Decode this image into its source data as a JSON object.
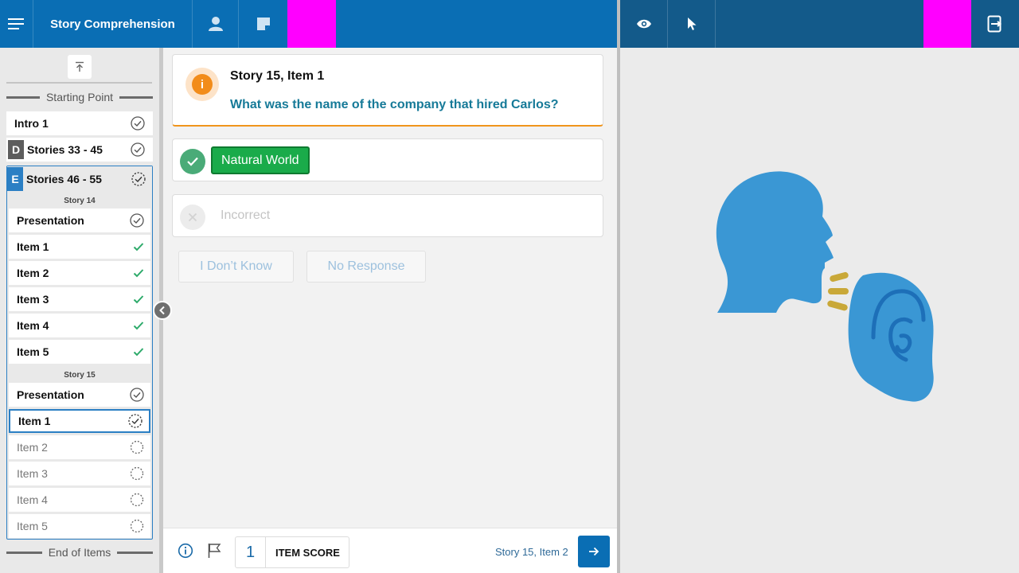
{
  "app": {
    "title": "Story Comprehension"
  },
  "colors": {
    "primary": "#0a6eb4",
    "secondary_bar": "#135a8a",
    "accent_orange": "#f28c1a",
    "success": "#1aab4a",
    "placeholder_magenta": "#ff00ff"
  },
  "topbar": {
    "left_icons": [
      "menu-icon",
      "user-icon",
      "note-icon"
    ],
    "right_icons": [
      "eye-icon",
      "pointer-icon",
      "exit-device-icon"
    ]
  },
  "sidebar": {
    "start_label": "Starting Point",
    "end_label": "End of Items",
    "top_items": [
      {
        "label": "Intro 1",
        "status": "complete"
      },
      {
        "badge": "D",
        "label": "Stories 33 - 45",
        "status": "complete"
      }
    ],
    "group": {
      "badge": "E",
      "label": "Stories 46 - 55",
      "status": "in-progress",
      "sections": [
        {
          "title": "Story 14",
          "items": [
            {
              "label": "Presentation",
              "status": "complete"
            },
            {
              "label": "Item 1",
              "status": "answered"
            },
            {
              "label": "Item 2",
              "status": "answered"
            },
            {
              "label": "Item 3",
              "status": "answered"
            },
            {
              "label": "Item 4",
              "status": "answered"
            },
            {
              "label": "Item 5",
              "status": "answered"
            }
          ]
        },
        {
          "title": "Story 15",
          "items": [
            {
              "label": "Presentation",
              "status": "complete"
            },
            {
              "label": "Item 1",
              "status": "current"
            },
            {
              "label": "Item 2",
              "status": "pending"
            },
            {
              "label": "Item 3",
              "status": "pending"
            },
            {
              "label": "Item 4",
              "status": "pending"
            },
            {
              "label": "Item 5",
              "status": "pending"
            }
          ]
        }
      ]
    }
  },
  "question": {
    "title": "Story 15, Item 1",
    "text": "What was the name of the company that hired Carlos?"
  },
  "answers": {
    "correct_label": "Natural World",
    "incorrect_label": "Incorrect"
  },
  "actions": {
    "dont_know": "I Don’t Know",
    "no_response": "No Response"
  },
  "footer": {
    "score_value": "1",
    "score_label": "ITEM SCORE",
    "next_item": "Story 15, Item 2"
  }
}
